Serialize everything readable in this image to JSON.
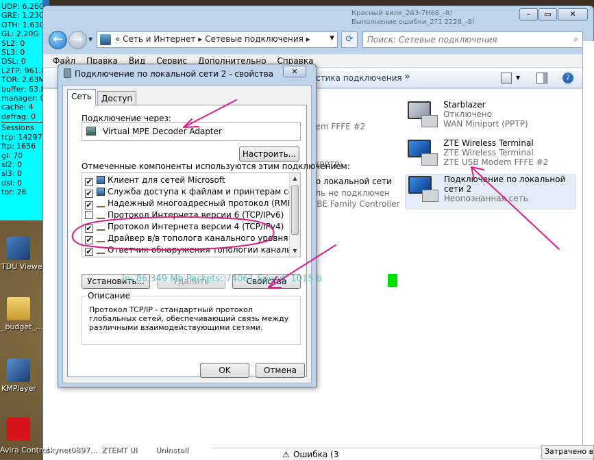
{
  "stats": {
    "lines": [
      "UDP: 6.26G",
      "GRE: 1.23G",
      "OTH: 1.63G",
      "GL: 2.20G",
      "SL2: 0",
      "SL3: 0",
      "DSL: 0",
      "L2TP: 961.8",
      "TOR: 2.63M",
      "buffer: 63.8",
      "manager: 0",
      "cache: 4",
      "defrag: 0"
    ],
    "lines2": [
      "Sessions",
      "tcp: 14297",
      "ftp: 1656",
      "gl: 70",
      "sl2: 0",
      "sl3: 0",
      "dsl: 0",
      "tor: 26"
    ]
  },
  "desktop": {
    "icons": [
      {
        "label": "TDU Viewer"
      },
      {
        "label": "_budget_..."
      },
      {
        "label": "KMPlayer"
      }
    ],
    "taskbar": [
      "Avira Control",
      "skynet0897...",
      "ZTEMT UI",
      "Uninstall"
    ]
  },
  "explorer": {
    "caption_text": [
      "Красный вилк_2й3-7Нё8_-8!",
      "Выполнение ошибки_2?1 2228_-8!"
    ],
    "address": {
      "sep": "«",
      "part1": "Сеть и Интернет",
      "arrow": "▸",
      "part2": "Сетевые подключения",
      "arrow2": "▸"
    },
    "search_placeholder": "Поиск: Сетевые подключения",
    "menu": [
      "Файл",
      "Правка",
      "Вид",
      "Сервис",
      "Дополнительно",
      "Справка"
    ],
    "cmd_partial": "стика подключения",
    "cmd_more": "»",
    "connections": [
      {
        "name": "Starblazer",
        "status": "Отключено",
        "device": "WAN Miniport (PPTP)"
      },
      {
        "name": "ZTE Wireless Terminal",
        "status": "ZTE Wireless Terminal",
        "device": "ZTE USB Modem FFFE #2"
      },
      {
        "name": "Подключение по локальной сети 2",
        "status": "Неопознанная сеть",
        "device": ""
      }
    ],
    "partials": [
      "dem FFFE #2",
      "A",
      "t (PPTP)",
      "по локальной сети",
      "ель не подключен",
      "GBE Family Controller"
    ],
    "bottom_status": "Ошибка (3",
    "right_bottom": "Затрачено вре"
  },
  "dialog": {
    "title": "Подключение по локальной сети 2 - свойства",
    "close": "✕",
    "tabs": [
      "Сеть",
      "Доступ"
    ],
    "connect_via_label": "Подключение через:",
    "adapter": "Virtual MPE Decoder Adapter",
    "configure_button": "Настроить...",
    "components_label": "Отмеченные компоненты используются этим подключением:",
    "components": [
      {
        "label": "Клиент для сетей Microsoft",
        "checked": true
      },
      {
        "label": "Служба доступа к файлам и принтерам сетей Micro...",
        "checked": true
      },
      {
        "label": "Надежный многоадресный протокол (RMP)",
        "checked": true
      },
      {
        "label": "Протокол Интернета версии 6 (TCP/IPv6)",
        "checked": false
      },
      {
        "label": "Протокол Интернета версии 4 (TCP/IPv4)",
        "checked": true
      },
      {
        "label": "Драйвер в/в тополога канального уровня",
        "checked": true
      },
      {
        "label": "Ответчик обнаружения топологии канального уровня",
        "checked": true
      }
    ],
    "install_button": "Установить...",
    "uninstall_button": "Удалить",
    "properties_button": "Свойства",
    "description_label": "Описание",
    "description_text": "Протокол TCP/IP - стандартный протокол глобальных сетей, обеспечивающий связь между различными взаимодействующими сетями.",
    "ok_button": "OK",
    "cancel_button": "Отмена"
  },
  "overlay": {
    "netstat": "In: 86.349 Mb Packets: 74061 Speed: 1015 b"
  },
  "colors": {
    "annotation": "#e0198a",
    "stats_bg": "#00ffff",
    "netstat": "#5fc1c6",
    "green": "#00e000"
  }
}
